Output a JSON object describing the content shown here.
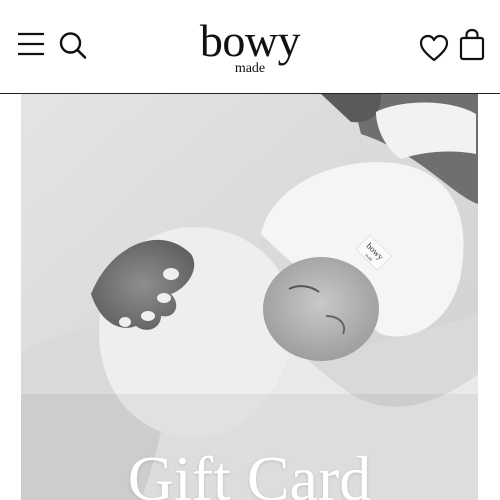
{
  "header": {
    "logo_main": "bowy",
    "logo_sub": "made",
    "icons": [
      "menu-icon",
      "search-icon",
      "heart-icon",
      "bag-icon"
    ]
  },
  "hero": {
    "title": "Gift Card",
    "hat_label": "bowy",
    "hat_label_sub": "made"
  },
  "colors": {
    "text": "#111111",
    "hero_overlay_text": "#ffffff",
    "divider": "#222222"
  }
}
